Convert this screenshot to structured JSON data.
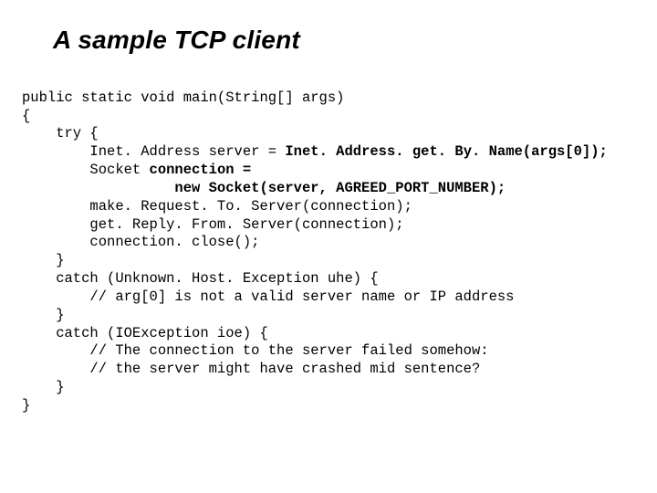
{
  "title": "A sample TCP client",
  "code": {
    "l0": "public static void main(String[] args)",
    "l1": "{",
    "l2": "    try {",
    "l3a": "        Inet. Address server = ",
    "l3b": "Inet. Address. get. By. Name(args[0]);",
    "l4a": "        Socket ",
    "l4b": "connection =",
    "l5": "                  new Socket(server, AGREED_PORT_NUMBER);",
    "l6": "        make. Request. To. Server(connection);",
    "l7": "        get. Reply. From. Server(connection);",
    "l8": "        connection. close();",
    "l9": "    }",
    "l10": "    catch (Unknown. Host. Exception uhe) {",
    "l11": "        // arg[0] is not a valid server name or IP address",
    "l12": "    }",
    "l13": "    catch (IOException ioe) {",
    "l14": "        // The connection to the server failed somehow:",
    "l15": "        // the server might have crashed mid sentence?",
    "l16": "    }",
    "l17": "}"
  }
}
